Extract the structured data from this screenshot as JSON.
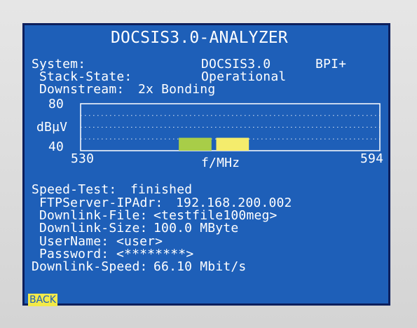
{
  "title": "DOCSIS3.0-ANALYZER",
  "system": {
    "label": "System:",
    "value": "DOCSIS3.0",
    "extra": "BPI+"
  },
  "stack_state": {
    "label": "Stack-State:",
    "value": "Operational"
  },
  "downstream": {
    "label": "Downstream:",
    "value": "2x Bonding"
  },
  "chart_data": {
    "type": "bar",
    "xlabel": "f/MHz",
    "ylabel": "dBµV",
    "xlim": [
      530,
      594
    ],
    "ylim": [
      40,
      80
    ],
    "x_ticks": [
      "530",
      "594"
    ],
    "y_ticks": [
      "80",
      "40"
    ],
    "grid": true,
    "bars": [
      {
        "x_start": 551,
        "x_end": 558,
        "value": 51,
        "color": "#a8cd48"
      },
      {
        "x_start": 559,
        "x_end": 566,
        "value": 51,
        "color": "#f4ec6c"
      }
    ]
  },
  "speed_test": {
    "status_label": "Speed-Test:",
    "status_value": "finished",
    "ftp_label": "FTPServer-IPAdr:",
    "ftp_value": "192.168.200.002",
    "file_label": "Downlink-File:",
    "file_value": "<testfile100meg>",
    "size_label": "Downlink-Size:",
    "size_value": "100.0 MByte",
    "user_label": "UserName:",
    "user_value": "<user>",
    "pass_label": "Password:",
    "pass_value": "<********>",
    "speed_label": "Downlink-Speed:",
    "speed_value": "66.10 Mbit/s"
  },
  "back_label": "BACK",
  "colors": {
    "screen_bg": "#1e5fb8",
    "text": "#ffffff",
    "bar_green": "#a8cd48",
    "bar_yellow": "#f4ec6c",
    "back_button": "#f2e94a"
  }
}
